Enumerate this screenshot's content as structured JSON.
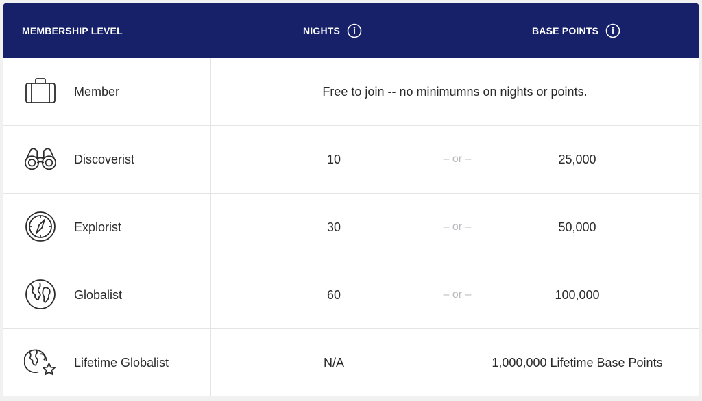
{
  "header": {
    "level": "MEMBERSHIP LEVEL",
    "nights": "NIGHTS",
    "base_points": "BASE POINTS"
  },
  "or_label": "– or –",
  "rows": [
    {
      "tier": "Member",
      "icon": "suitcase-icon",
      "note": "Free to join -- no minimumns on nights or points."
    },
    {
      "tier": "Discoverist",
      "icon": "binoculars-icon",
      "nights": "10",
      "points": "25,000"
    },
    {
      "tier": "Explorist",
      "icon": "compass-icon",
      "nights": "30",
      "points": "50,000"
    },
    {
      "tier": "Globalist",
      "icon": "globe-icon",
      "nights": "60",
      "points": "100,000"
    },
    {
      "tier": "Lifetime Globalist",
      "icon": "globe-star-icon",
      "nights": "N/A",
      "points": "1,000,000 Lifetime Base Points"
    }
  ],
  "colors": {
    "header_bg": "#16216a",
    "header_text": "#ffffff",
    "divider": "#e4e4e6",
    "or_text": "#b9b9be"
  }
}
